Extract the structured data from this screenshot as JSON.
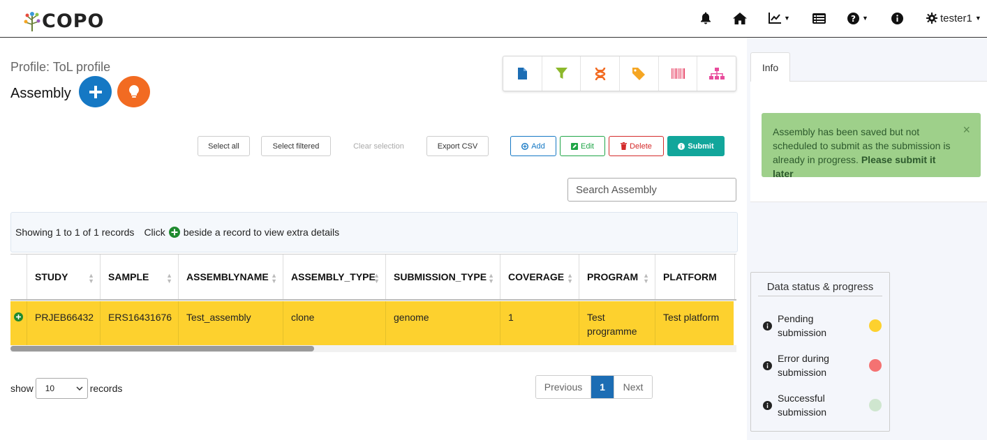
{
  "navbar": {
    "logo_text": "COPO",
    "user_name": "tester1"
  },
  "profile_title": "Profile: ToL profile",
  "component_title": "Assembly",
  "selection": {
    "select_all": "Select all",
    "select_filtered": "Select filtered",
    "clear_selection": "Clear selection",
    "export_csv": "Export CSV"
  },
  "actions": {
    "add": "Add",
    "edit": "Edit",
    "delete": "Delete",
    "submit": "Submit"
  },
  "search": {
    "placeholder": "Search Assembly"
  },
  "info_bar": {
    "showing": "Showing 1 to 1 of 1 records",
    "click": "Click",
    "hint": "beside a record to view extra details"
  },
  "table": {
    "columns": [
      "STUDY",
      "SAMPLE",
      "ASSEMBLYNAME",
      "ASSEMBLY_TYPE",
      "SUBMISSION_TYPE",
      "COVERAGE",
      "PROGRAM",
      "PLATFORM"
    ],
    "rows": [
      [
        "PRJEB66432",
        "ERS16431676",
        "Test_assembly",
        "clone",
        "genome",
        "1",
        "Test programme",
        "Test platform"
      ]
    ]
  },
  "length": {
    "show": "show",
    "value": "10",
    "records": "records"
  },
  "pagination": {
    "previous": "Previous",
    "current": "1",
    "next": "Next"
  },
  "right": {
    "tab": "Info",
    "alert": {
      "text": "Assembly has been saved but not scheduled to submit as the submission is already in progress.",
      "strong": "Please submit it later",
      "close": "×"
    },
    "status": {
      "title": "Data status & progress",
      "items": [
        {
          "label": "Pending submission",
          "color": "#fdd12e"
        },
        {
          "label": "Error during submission",
          "color": "#f47272"
        },
        {
          "label": "Successful submission",
          "color": "#cfe6cf"
        }
      ]
    }
  },
  "colors": {
    "row_highlight": "#fdd12e",
    "primary": "#1578c4",
    "accent_orange": "#f26b22",
    "submit_teal": "#12a69b"
  }
}
